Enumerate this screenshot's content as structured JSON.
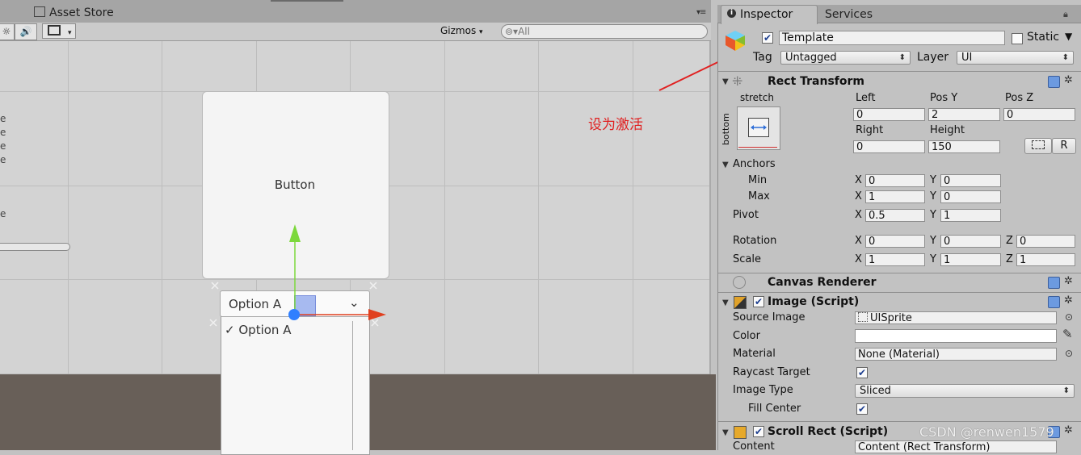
{
  "scene": {
    "asset_store_tab": "Asset Store",
    "gizmos_label": "Gizmos",
    "search_placeholder": "All",
    "button_label": "Button",
    "dropdown_label": "Option A",
    "dropdown_item_label": "Option A",
    "item_check": "✓",
    "edge_glyph": "e",
    "panel_menu": "▾≡"
  },
  "annotation": "设为激活",
  "inspector": {
    "tab_inspector": "Inspector",
    "tab_services": "Services",
    "go_name": "Template",
    "go_active": true,
    "static_label": "Static",
    "tag_label": "Tag",
    "tag_value": "Untagged",
    "layer_label": "Layer",
    "layer_value": "UI",
    "rect_transform": {
      "title": "Rect Transform",
      "stretch_label": "stretch",
      "bottom_label": "bottom",
      "left_label": "Left",
      "left_value": "0",
      "posy_label": "Pos Y",
      "posy_value": "2",
      "posz_label": "Pos Z",
      "posz_value": "0",
      "right_label": "Right",
      "right_value": "0",
      "height_label": "Height",
      "height_value": "150",
      "r_button": "R",
      "anchors_label": "Anchors",
      "min_label": "Min",
      "min_x": "0",
      "min_y": "0",
      "max_label": "Max",
      "max_x": "1",
      "max_y": "0",
      "pivot_label": "Pivot",
      "pivot_x": "0.5",
      "pivot_y": "1",
      "rotation_label": "Rotation",
      "rot_x": "0",
      "rot_y": "0",
      "rot_z": "0",
      "scale_label": "Scale",
      "scale_x": "1",
      "scale_y": "1",
      "scale_z": "1",
      "x": "X",
      "y": "Y",
      "z": "Z"
    },
    "canvas_renderer": {
      "title": "Canvas Renderer"
    },
    "image": {
      "title": "Image (Script)",
      "source_image_label": "Source Image",
      "source_image_value": "UISprite",
      "color_label": "Color",
      "color_value": "#ffffff",
      "material_label": "Material",
      "material_value": "None (Material)",
      "raycast_label": "Raycast Target",
      "raycast_checked": true,
      "image_type_label": "Image Type",
      "image_type_value": "Sliced",
      "fill_center_label": "Fill Center",
      "fill_center_checked": true
    },
    "scroll_rect": {
      "title": "Scroll Rect (Script)",
      "content_label": "Content",
      "content_value": "Content (Rect Transform)"
    }
  },
  "watermark": "CSDN @renwen1579",
  "colors": {
    "accent_red": "#e02020",
    "gizmo_green": "#7cd83c",
    "gizmo_red": "#e0401f",
    "gizmo_blue": "#2f7fff"
  }
}
